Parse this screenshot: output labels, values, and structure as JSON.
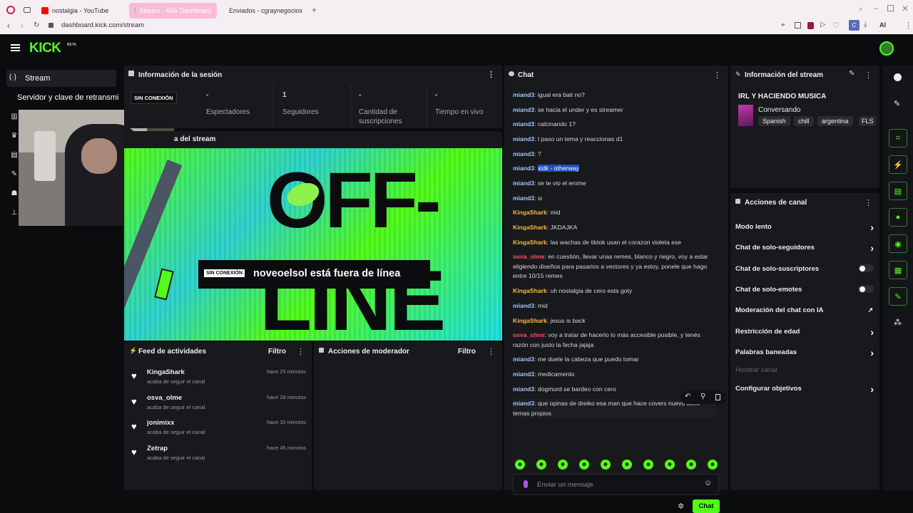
{
  "browser": {
    "tabs": [
      {
        "label": "nostalgia - YouTube",
        "color": "#ff0000"
      },
      {
        "label": "Stream - Kick Dashboard",
        "color": "#53fc18"
      },
      {
        "label": "Enviados - cgraynegocios",
        "color": "#ea4335"
      }
    ],
    "url": "dashboard.kick.com/stream",
    "avatar_letter": "C",
    "ai_label": "AI"
  },
  "app": {
    "logo": "KICK",
    "logo_badge": "BETA",
    "accent": "#53fc18"
  },
  "sidebar": {
    "active": "Stream",
    "subitem": "Servidor y clave de retransmi"
  },
  "session": {
    "title": "Información de la sesión",
    "offline_badge": "SIN CONEXIÓN",
    "stats": [
      {
        "value": "-",
        "label": "Espectadores"
      },
      {
        "value": "1",
        "label": "Seguidores"
      },
      {
        "value": "-",
        "label": "Cantidad de suscripciones"
      },
      {
        "value": "-",
        "label": "Tiempo en vivo"
      }
    ]
  },
  "preview": {
    "title_partial": "a del stream",
    "offline_badge": "SIN CONEXIÓN",
    "offline_text": "noveoelsol está fuera de línea",
    "bg_word_1": "OFF-",
    "bg_word_2": "LINE"
  },
  "feed": {
    "title": "Feed de actividades",
    "filter": "Filtro",
    "items": [
      {
        "name": "KingaShark",
        "sub": "acaba de seguir el canal",
        "time": "hace 25 minutos"
      },
      {
        "name": "osva_olme",
        "sub": "acaba de seguir el canal",
        "time": "hace 28 minutos"
      },
      {
        "name": "jonimixx",
        "sub": "acaba de seguir el canal",
        "time": "hace 30 minutos"
      },
      {
        "name": "Zetrap",
        "sub": "acaba de seguir el canal",
        "time": "hace 45 minutos"
      }
    ]
  },
  "modactions": {
    "title": "Acciones de moderador",
    "filter": "Filtro"
  },
  "chat": {
    "title": "Chat",
    "messages": [
      {
        "user": "miand3",
        "color": "#9ec5ff",
        "text": "igual era bait no?"
      },
      {
        "user": "miand3",
        "color": "#9ec5ff",
        "text": "se hacia el under y es streamer"
      },
      {
        "user": "miand3",
        "color": "#9ec5ff",
        "text": "calcinando 1?"
      },
      {
        "user": "miand3",
        "color": "#9ec5ff",
        "text": "t paso un tema y reaccionas d1"
      },
      {
        "user": "miand3",
        "color": "#9ec5ff",
        "text": "?"
      },
      {
        "user": "miand3",
        "color": "#9ec5ff",
        "text": "xidk - otherway",
        "highlight": true
      },
      {
        "user": "miand3",
        "color": "#9ec5ff",
        "text": "se te vio el erome"
      },
      {
        "user": "miand3",
        "color": "#9ec5ff",
        "text": "si"
      },
      {
        "user": "KingaShark",
        "color": "#f5b942",
        "text": "mid"
      },
      {
        "user": "KingaShark",
        "color": "#f5b942",
        "text": "JKDAJKA"
      },
      {
        "user": "KingaShark",
        "color": "#f5b942",
        "text": "las wachas de tiktok usan el corazon violeta ese"
      },
      {
        "user": "osva_olme",
        "color": "#ff4d6d",
        "text": "en cuestión, llevar unas remes, blanco y negro, voy a estar eligiendo diseños para pasarios a vectores y ya estoy, ponele que hago entre 10/15 remes"
      },
      {
        "user": "KingaShark",
        "color": "#f5b942",
        "text": "uh nostalgia de cero esta goty"
      },
      {
        "user": "miand3",
        "color": "#9ec5ff",
        "text": "mid"
      },
      {
        "user": "KingaShark",
        "color": "#f5b942",
        "text": "jesus is back"
      },
      {
        "user": "osva_olme",
        "color": "#ff4d6d",
        "text": "voy a tratar de hacerlo lo más accesible posible, y tenés razón con justo la fecha jajaja"
      },
      {
        "user": "miand3",
        "color": "#9ec5ff",
        "text": "me duele la cabeza que puedo tomar"
      },
      {
        "user": "miand3",
        "color": "#9ec5ff",
        "text": "medicamento"
      },
      {
        "user": "miand3",
        "color": "#9ec5ff",
        "text": "dogmurd se bardeo con cero"
      },
      {
        "user": "miand3",
        "color": "#9ec5ff",
        "text": "que opinas de dreiko esa man que hace covers nuevo tiene temas propios"
      }
    ],
    "placeholder": "Enviar un mensaje",
    "send_label": "Chat"
  },
  "streaminfo": {
    "title": "Información del stream",
    "stream_title": "IRL Y HACIENDO MUSICA",
    "category": "Conversando",
    "tags": [
      "Spanish",
      "chill",
      "argentina",
      "FLS"
    ]
  },
  "channel": {
    "title": "Acciones de canal",
    "rows": [
      {
        "label": "Modo lento",
        "control": "chevron"
      },
      {
        "label": "Chat de solo-seguidores",
        "control": "chevron"
      },
      {
        "label": "Chat de solo-suscriptores",
        "control": "toggle"
      },
      {
        "label": "Chat de solo-emotes",
        "control": "toggle"
      },
      {
        "label": "Moderación del chat con IA",
        "control": "external"
      },
      {
        "label": "Restricción de edad",
        "control": "chevron"
      },
      {
        "label": "Palabras baneadas",
        "control": "chevron"
      },
      {
        "label": "Hostear canal",
        "control": "disabled"
      },
      {
        "label": "Configurar objetivos",
        "control": "chevron"
      }
    ]
  }
}
